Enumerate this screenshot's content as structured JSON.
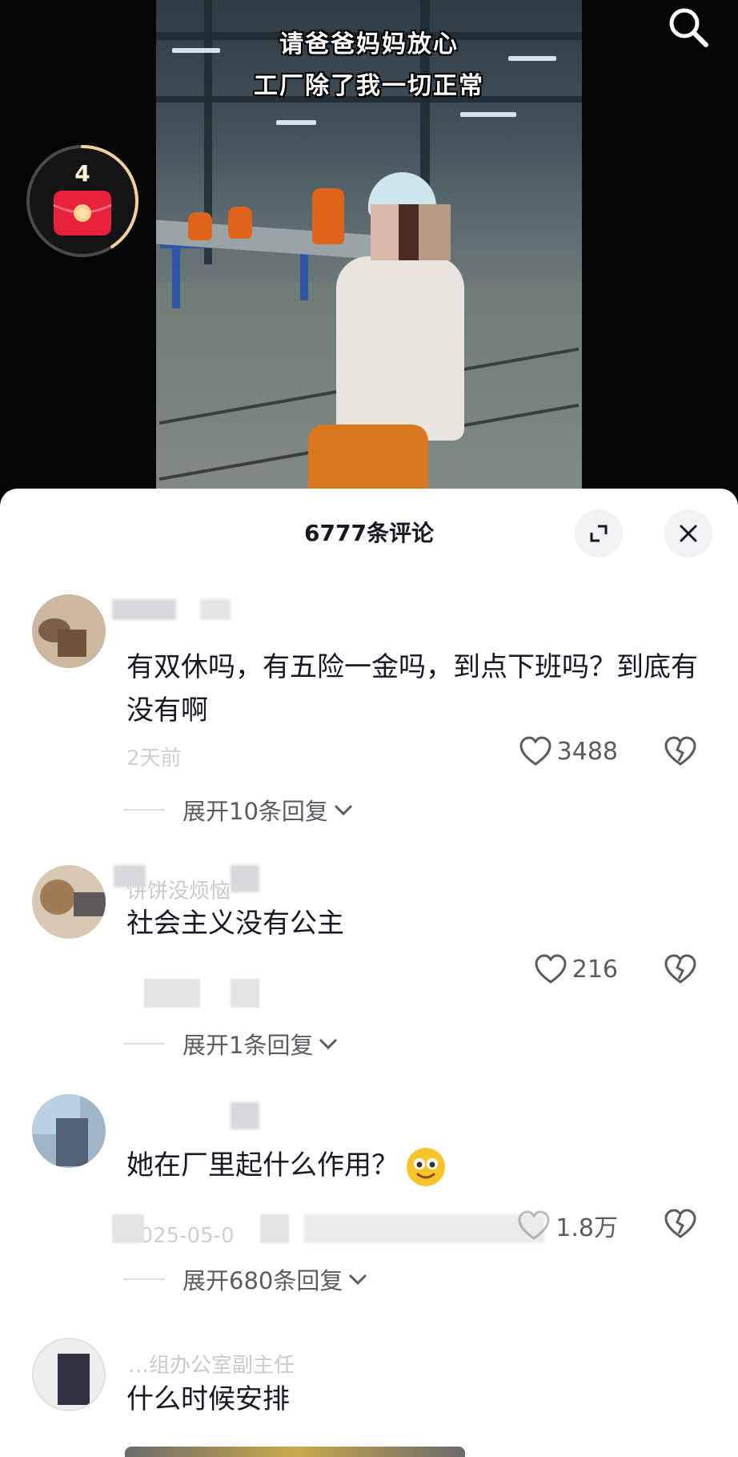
{
  "video": {
    "caption_line1": "请爸爸妈妈放心",
    "caption_line2": "工厂除了我一切正常"
  },
  "search": {
    "icon": "search-icon"
  },
  "red_packet": {
    "count": "4",
    "icon": "red-envelope-icon",
    "ring_color": "#f3d19a"
  },
  "sheet": {
    "title": "6777条评论",
    "expand_icon": "expand-icon",
    "close_icon": "close-icon"
  },
  "comments": [
    {
      "text": "有双休吗，有五险一金吗，到点下班吗？到底有没有啊",
      "meta": "2天前",
      "likes": "3488",
      "replies": "展开10条回复"
    },
    {
      "name": "饼饼没烦恼",
      "text": "社会主义没有公主",
      "likes": "216",
      "replies": "展开1条回复"
    },
    {
      "text": "她在厂里起什么作用？",
      "meta": "2025-05-0",
      "likes": "1.8万",
      "replies": "展开680条回复"
    },
    {
      "name": "…组办公室副主任",
      "text": "什么时候安排"
    }
  ],
  "colors": {
    "sheet_bg": "#ffffff",
    "text_primary": "#161823",
    "text_secondary": "#5b5c61",
    "red_packet": "#e8213a"
  }
}
